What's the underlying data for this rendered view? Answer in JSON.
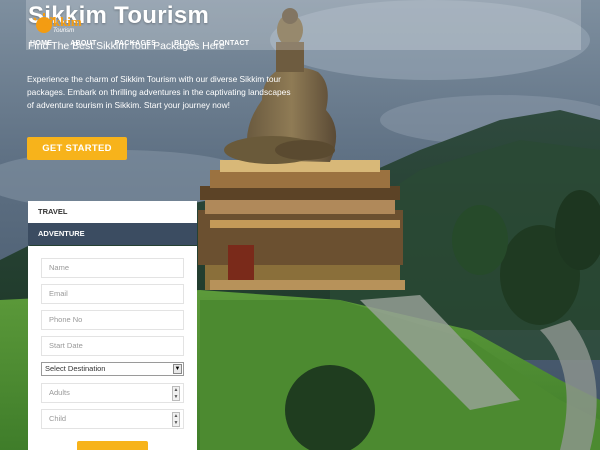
{
  "brand": {
    "title": "Sikkim Tourism",
    "logo_text": "Sikkim",
    "logo_sub": "Tourism"
  },
  "tagline": "Find The Best Sikkim Tour Packages Here",
  "nav": [
    {
      "label": "Home"
    },
    {
      "label": "About"
    },
    {
      "label": "Packages"
    },
    {
      "label": "Blog"
    },
    {
      "label": "Contact"
    }
  ],
  "hero": {
    "description": "Experience the charm of Sikkim Tourism with our diverse Sikkim tour packages. Embark on thrilling adventures in the captivating landscapes of adventure tourism in Sikkim. Start your journey now!",
    "cta_label": "GET STARTED"
  },
  "booking": {
    "tabs": [
      {
        "label": "TRAVEL"
      },
      {
        "label": "ADVENTURE"
      }
    ],
    "active_tab": "ADVENTURE",
    "fields": {
      "name": "Name",
      "email": "Email",
      "phone": "Phone No",
      "start_date": "Start Date",
      "destination": "Select Destination",
      "adults": "Adults",
      "child": "Child"
    }
  },
  "colors": {
    "accent": "#f7b31b",
    "tab_active": "#3b4c61",
    "logo": "#f39c12"
  }
}
